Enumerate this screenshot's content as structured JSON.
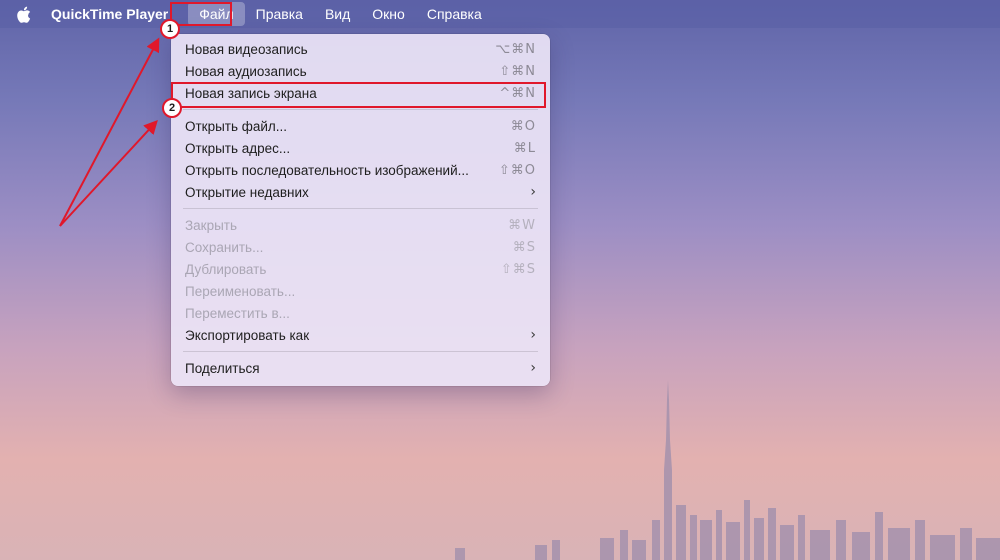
{
  "menubar": {
    "app_name": "QuickTime Player",
    "items": [
      "Файл",
      "Правка",
      "Вид",
      "Окно",
      "Справка"
    ]
  },
  "file_menu": {
    "group1": [
      {
        "label": "Новая видеозапись",
        "shortcut": "⌥⌘N"
      },
      {
        "label": "Новая аудиозапись",
        "shortcut": "⇧⌘N"
      },
      {
        "label": "Новая запись экрана",
        "shortcut": "^⌘N"
      }
    ],
    "group2": [
      {
        "label": "Открыть файл...",
        "shortcut": "⌘O"
      },
      {
        "label": "Открыть адрес...",
        "shortcut": "⌘L"
      },
      {
        "label": "Открыть последовательность изображений...",
        "shortcut": "⇧⌘O"
      },
      {
        "label": "Открытие недавних",
        "shortcut": "›"
      }
    ],
    "group3": [
      {
        "label": "Закрыть",
        "shortcut": "⌘W"
      },
      {
        "label": "Сохранить...",
        "shortcut": "⌘S"
      },
      {
        "label": "Дублировать",
        "shortcut": "⇧⌘S"
      },
      {
        "label": "Переименовать..."
      },
      {
        "label": "Переместить в..."
      },
      {
        "label": "Экспортировать как",
        "shortcut": "›"
      }
    ],
    "group4": [
      {
        "label": "Поделиться",
        "shortcut": "›"
      }
    ]
  },
  "annotations": {
    "badge1": "1",
    "badge2": "2",
    "accent_color": "#e0182b"
  }
}
